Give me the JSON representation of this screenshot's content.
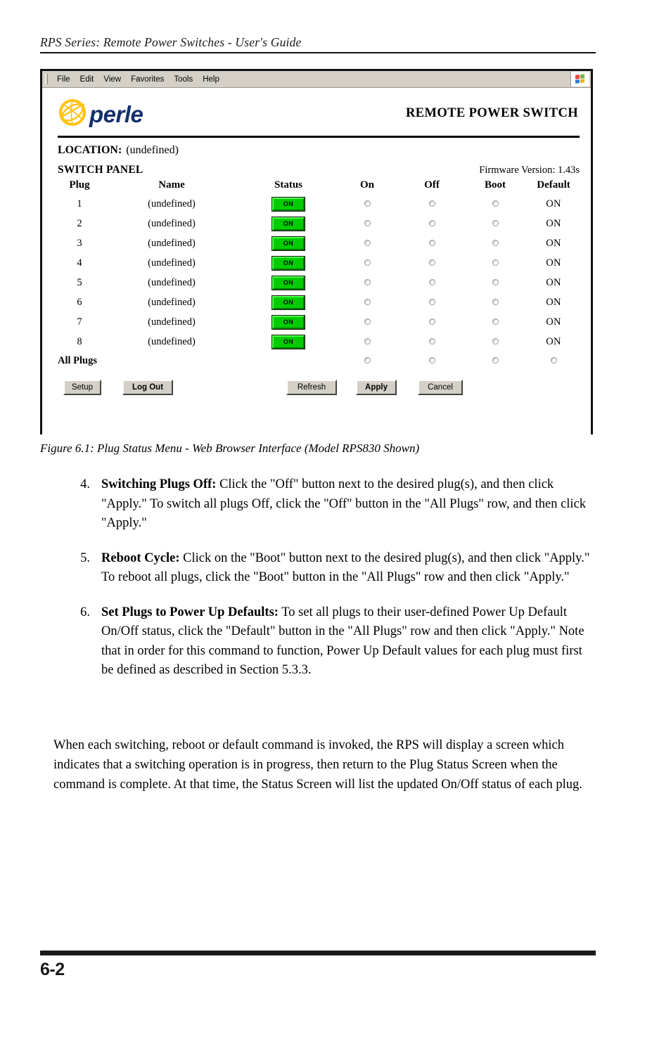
{
  "running_head": "RPS Series: Remote Power Switches - User's Guide",
  "browser": {
    "menu_items": [
      "File",
      "Edit",
      "View",
      "Favorites",
      "Tools",
      "Help"
    ],
    "brand_icon": "windows-flag-icon"
  },
  "app": {
    "logo_text": "perle",
    "logo_mark": "perle-globe-icon",
    "logo_color": "#13306b",
    "logo_mark_color": "#ffc20e",
    "device_title": "REMOTE POWER SWITCH",
    "location_label": "LOCATION:",
    "location_value": "(undefined)",
    "panel_title": "SWITCH PANEL",
    "firmware": "Firmware Version: 1.43s",
    "status_on_color": "#00cc00"
  },
  "table": {
    "headers": [
      "Plug",
      "Name",
      "Status",
      "On",
      "Off",
      "Boot",
      "Default"
    ],
    "rows": [
      {
        "plug": "1",
        "name": "(undefined)",
        "status": "ON",
        "default": "ON"
      },
      {
        "plug": "2",
        "name": "(undefined)",
        "status": "ON",
        "default": "ON"
      },
      {
        "plug": "3",
        "name": "(undefined)",
        "status": "ON",
        "default": "ON"
      },
      {
        "plug": "4",
        "name": "(undefined)",
        "status": "ON",
        "default": "ON"
      },
      {
        "plug": "5",
        "name": "(undefined)",
        "status": "ON",
        "default": "ON"
      },
      {
        "plug": "6",
        "name": "(undefined)",
        "status": "ON",
        "default": "ON"
      },
      {
        "plug": "7",
        "name": "(undefined)",
        "status": "ON",
        "default": "ON"
      },
      {
        "plug": "8",
        "name": "(undefined)",
        "status": "ON",
        "default": "ON"
      }
    ],
    "all_plugs_label": "All Plugs"
  },
  "buttons": {
    "setup": "Setup",
    "logout": "Log Out",
    "refresh": "Refresh",
    "apply": "Apply",
    "cancel": "Cancel"
  },
  "figure_caption": "Figure 6.1:  Plug Status Menu - Web Browser Interface (Model RPS830 Shown)",
  "steps": [
    {
      "num": "4.",
      "term": "Switching Plugs Off:",
      "text": "  Click the \"Off\" button next to the desired plug(s), and then click \"Apply.\"  To switch all plugs Off, click the \"Off\" button in the \"All Plugs\" row, and then click \"Apply.\""
    },
    {
      "num": "5.",
      "term": "Reboot Cycle:",
      "text": "  Click on the \"Boot\" button next to the desired plug(s), and then click \"Apply.\"  To reboot all plugs, click the \"Boot\" button in the \"All Plugs\" row and then click \"Apply.\""
    },
    {
      "num": "6.",
      "term": "Set Plugs to Power Up Defaults:",
      "text": "  To set all plugs to their user-defined Power Up Default On/Off status, click the \"Default\" button in the \"All Plugs\" row and then click \"Apply.\"  Note that in order for this command to function, Power Up Default values for each plug must first be defined as described in Section 5.3.3."
    }
  ],
  "closing_paragraph": "When each switching, reboot or default command is invoked, the RPS will display a screen which indicates that a switching operation is in progress, then return to the Plug Status Screen when the command is complete.  At that time, the Status Screen will list the updated On/Off status of each plug.",
  "footer": {
    "page_number": "6-2"
  }
}
